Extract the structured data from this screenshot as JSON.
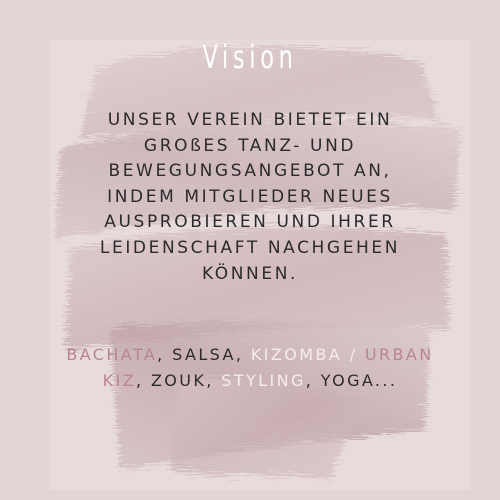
{
  "title": "Vision",
  "vision_text": {
    "lines": [
      "UNSER VEREIN BIETET EIN",
      "GROßES TANZ- UND",
      "BEWEGUNGSANGEBOT AN,",
      "INDEM MITGLIEDER NEUES",
      "AUSPROBIEREN UND IHRER",
      "LEIDENSCHAFT NACHGEHEN",
      "KÖNNEN."
    ]
  },
  "dance_styles": {
    "line1": {
      "bachata": "BACHATA",
      "sep1": ", ",
      "salsa": "SALSA",
      "sep2": ", ",
      "kizomba": "KIZOMBA",
      "slash": " / ",
      "urban": "URBAN"
    },
    "line2": {
      "kiz": "KIZ",
      "sep1": ", ",
      "zouk": "ZOUK",
      "sep2": ", ",
      "styling": "STYLING",
      "sep3": ", ",
      "yoga": "YOGA..."
    }
  },
  "colors": {
    "background": "#e3d4d6",
    "brush_stroke": "#c2a3a8",
    "text_dark": "#2b2b2b",
    "highlight_pink": "#b8868c",
    "highlight_white": "#f5eeef"
  }
}
